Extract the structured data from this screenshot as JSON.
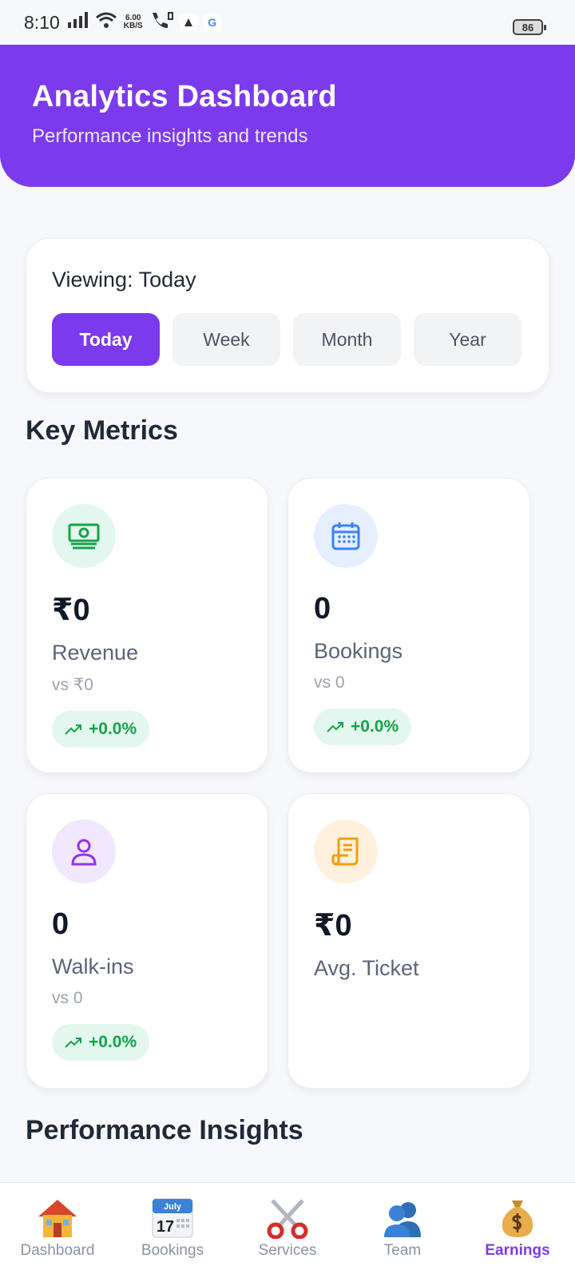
{
  "status_bar": {
    "time": "8:10",
    "net_speed_value": "6.00",
    "net_speed_unit": "KB/S",
    "google_letter": "G",
    "battery": "86"
  },
  "header": {
    "title": "Analytics Dashboard",
    "subtitle": "Performance insights and trends"
  },
  "period": {
    "viewing_label": "Viewing: Today",
    "options": [
      "Today",
      "Week",
      "Month",
      "Year"
    ],
    "selected": "Today"
  },
  "key_metrics": {
    "title": "Key Metrics",
    "cards": [
      {
        "icon": "money-icon",
        "value": "₹0",
        "label": "Revenue",
        "compare": "vs ₹0",
        "change": "+0.0%",
        "icon_bg": "#e3f7ee",
        "icon_color": "#16a34a"
      },
      {
        "icon": "calendar-icon",
        "value": "0",
        "label": "Bookings",
        "compare": "vs 0",
        "change": "+0.0%",
        "icon_bg": "#e6efff",
        "icon_color": "#3b82f6"
      },
      {
        "icon": "user-icon",
        "value": "0",
        "label": "Walk-ins",
        "compare": "vs 0",
        "change": "+0.0%",
        "icon_bg": "#f1e8ff",
        "icon_color": "#9333ea"
      },
      {
        "icon": "receipt-icon",
        "value": "₹0",
        "label": "Avg. Ticket",
        "icon_bg": "#fff1de",
        "icon_color": "#f59e0b"
      }
    ]
  },
  "insights": {
    "title": "Performance Insights"
  },
  "bottom_nav": {
    "items": [
      {
        "label": "Dashboard",
        "icon": "house-icon"
      },
      {
        "label": "Bookings",
        "icon": "calendar-icon",
        "calendar_month": "July",
        "calendar_day": "17"
      },
      {
        "label": "Services",
        "icon": "scissors-icon"
      },
      {
        "label": "Team",
        "icon": "team-icon"
      },
      {
        "label": "Earnings",
        "icon": "money-bag-icon"
      }
    ],
    "active": "Earnings"
  },
  "colors": {
    "primary": "#7c3aed",
    "positive": "#16a34a"
  }
}
